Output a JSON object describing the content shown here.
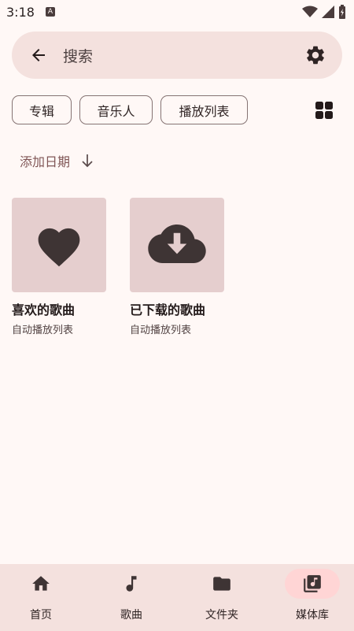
{
  "status": {
    "time": "3:18",
    "notif_glyph": "A"
  },
  "search": {
    "placeholder": "搜索"
  },
  "chips": [
    {
      "label": "专辑"
    },
    {
      "label": "音乐人"
    },
    {
      "label": "播放列表"
    }
  ],
  "sort": {
    "label": "添加日期",
    "direction": "descending"
  },
  "cards": [
    {
      "title": "喜欢的歌曲",
      "subtitle": "自动播放列表",
      "icon": "heart-icon"
    },
    {
      "title": "已下载的歌曲",
      "subtitle": "自动播放列表",
      "icon": "cloud-download-icon"
    }
  ],
  "nav": [
    {
      "label": "首页",
      "icon": "home-icon",
      "active": false
    },
    {
      "label": "歌曲",
      "icon": "music-note-icon",
      "active": false
    },
    {
      "label": "文件夹",
      "icon": "folder-icon",
      "active": false
    },
    {
      "label": "媒体库",
      "icon": "library-music-icon",
      "active": true
    }
  ],
  "colors": {
    "background": "#fff8f6",
    "surface": "#f4e1de",
    "thumb": "#e5cece",
    "accent_pill": "#ffd5d5",
    "icon_dark": "#3e3434"
  }
}
